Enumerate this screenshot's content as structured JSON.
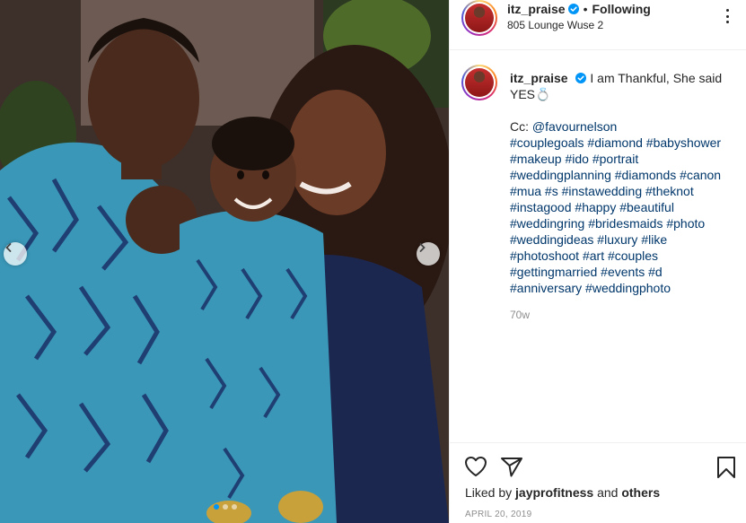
{
  "post": {
    "username": "itz_praise",
    "follow_separator": "•",
    "follow_status": "Following",
    "location": "805 Lounge Wuse 2",
    "verified_icon": "verified-badge-icon",
    "caption_text": "I am Thankful, She said YES",
    "caption_emoji": "💍",
    "cc_label": "Cc:",
    "mention": "@favournelson",
    "hashtags": [
      "#couplegoals",
      "#diamond",
      "#babyshower",
      "#makeup",
      "#ido",
      "#portrait",
      "#weddingplanning",
      "#diamonds",
      "#canon",
      "#mua",
      "#s",
      "#instawedding",
      "#theknot",
      "#instagood",
      "#happy",
      "#beautiful",
      "#weddingring",
      "#bridesmaids",
      "#photo",
      "#weddingideas",
      "#luxury",
      "#like",
      "#photoshoot",
      "#art",
      "#couples",
      "#gettingmarried",
      "#events",
      "#d",
      "#anniversary",
      "#weddingphoto"
    ],
    "time_ago": "70w",
    "liked_by_prefix": "Liked by",
    "liked_by_user": "jayprofitness",
    "liked_by_and": "and",
    "liked_by_others": "others",
    "date": "APRIL 20, 2019"
  },
  "carousel": {
    "total_slides": 3,
    "active_slide": 1
  },
  "colors": {
    "accent_blue": "#0095f6",
    "link_blue": "#00376b",
    "text": "#262626",
    "muted": "#8e8e8e"
  },
  "icons": [
    "more-options-icon",
    "heart-icon",
    "paper-plane-icon",
    "bookmark-icon",
    "chevron-left-icon",
    "chevron-right-icon"
  ]
}
